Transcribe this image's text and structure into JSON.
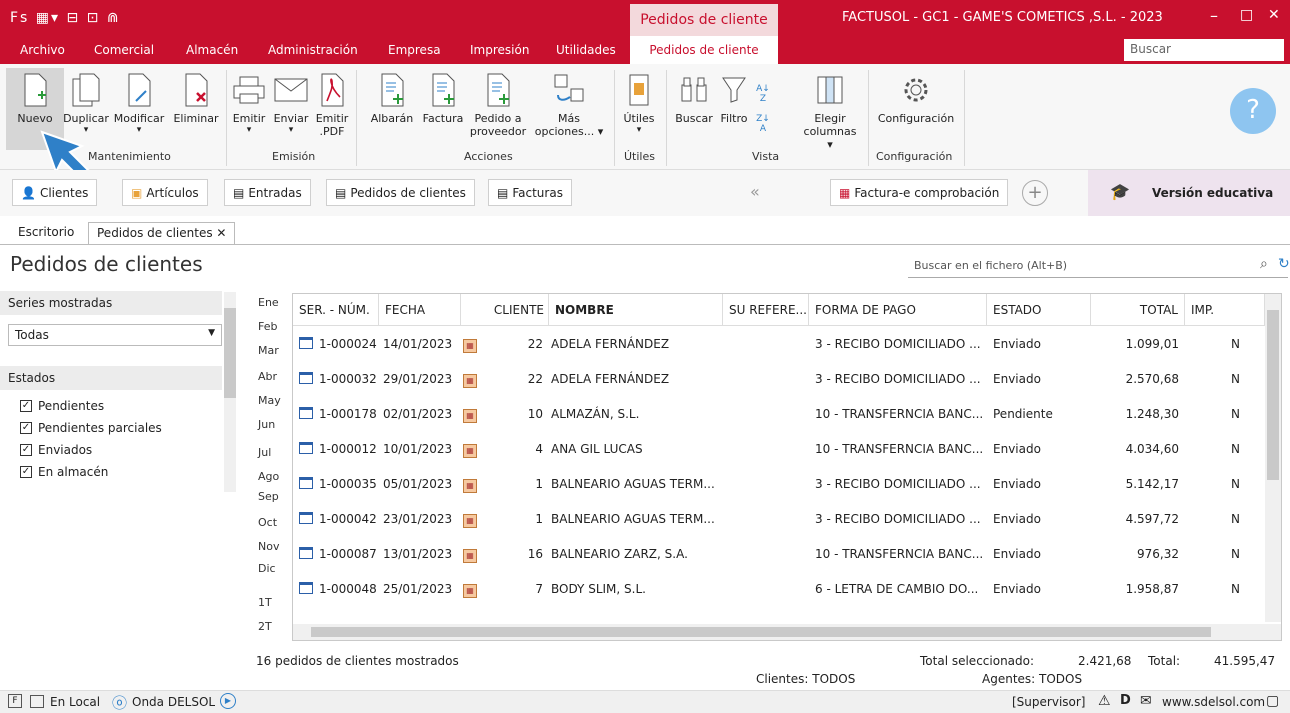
{
  "titlebar": {
    "quick_icons": "Fs ▦▾ ⊟ ⊡ ⋒",
    "context_tab": "Pedidos de cliente",
    "app_title": "FACTUSOL - GC1 - GAME'S COMETICS ,S.L. - 2023",
    "min": "–",
    "max": "□",
    "close": "✕"
  },
  "menu": {
    "items": [
      "Archivo",
      "Comercial",
      "Almacén",
      "Administración",
      "Empresa",
      "Impresión",
      "Utilidades",
      "Pedidos de cliente"
    ],
    "search_placeholder": "Buscar"
  },
  "ribbon": {
    "buttons": {
      "nuevo": "Nuevo",
      "duplicar": "Duplicar",
      "modificar": "Modificar",
      "eliminar": "Eliminar",
      "emitir": "Emitir",
      "enviar": "Enviar",
      "emitir_pdf_1": "Emitir",
      "emitir_pdf_2": ".PDF",
      "albaran": "Albarán",
      "factura": "Factura",
      "pedido_prov_1": "Pedido a",
      "pedido_prov_2": "proveedor",
      "mas_1": "Más",
      "mas_2": "opciones... ▾",
      "utiles": "Útiles",
      "buscar": "Buscar",
      "filtro": "Filtro",
      "elegir_1": "Elegir",
      "elegir_2": "columnas ▾",
      "configuracion": "Configuración"
    },
    "groups": {
      "mantenimiento": "Mantenimiento",
      "emision": "Emisión",
      "acciones": "Acciones",
      "utiles": "Útiles",
      "vista": "Vista",
      "configuracion": "Configuración"
    }
  },
  "nav": {
    "clientes": "Clientes",
    "articulos": "Artículos",
    "entradas": "Entradas",
    "pedidos": "Pedidos de clientes",
    "facturas": "Facturas",
    "collapse": "«",
    "facturae": "Factura-e comprobación",
    "plus": "+",
    "edu": "Versión educativa"
  },
  "tabs": {
    "escritorio": "Escritorio",
    "pedidos": "Pedidos de clientes ✕"
  },
  "page": {
    "title": "Pedidos de clientes",
    "search_placeholder": "Buscar en el fichero (Alt+B)"
  },
  "left": {
    "series_label": "Series mostradas",
    "series_value": "Todas",
    "estados_label": "Estados",
    "estados": [
      "Pendientes",
      "Pendientes parciales",
      "Enviados",
      "En almacén"
    ]
  },
  "months": [
    "Ene",
    "Feb",
    "Mar",
    "Abr",
    "May",
    "Jun",
    "Jul",
    "Ago",
    "Sep",
    "Oct",
    "Nov",
    "Dic",
    "1T",
    "2T"
  ],
  "table": {
    "headers": [
      "SER. - NÚM.",
      "FECHA",
      "CLIENTE",
      "NOMBRE",
      "SU REFERE...",
      "FORMA DE PAGO",
      "ESTADO",
      "TOTAL",
      "IMP."
    ],
    "rows": [
      [
        "1-000024",
        "14/01/2023",
        "22",
        "ADELA FERNÁNDEZ",
        "",
        "3 - RECIBO DOMICILIADO ...",
        "Enviado",
        "1.099,01",
        "N"
      ],
      [
        "1-000032",
        "29/01/2023",
        "22",
        "ADELA FERNÁNDEZ",
        "",
        "3 - RECIBO DOMICILIADO ...",
        "Enviado",
        "2.570,68",
        "N"
      ],
      [
        "1-000178",
        "02/01/2023",
        "10",
        "ALMAZÁN, S.L.",
        "",
        "10 - TRANSFERNCIA BANC...",
        "Pendiente",
        "1.248,30",
        "N"
      ],
      [
        "1-000012",
        "10/01/2023",
        "4",
        "ANA GIL LUCAS",
        "",
        "10 - TRANSFERNCIA BANC...",
        "Enviado",
        "4.034,60",
        "N"
      ],
      [
        "1-000035",
        "05/01/2023",
        "1",
        "BALNEARIO AGUAS TERM...",
        "",
        "3 - RECIBO DOMICILIADO ...",
        "Enviado",
        "5.142,17",
        "N"
      ],
      [
        "1-000042",
        "23/01/2023",
        "1",
        "BALNEARIO AGUAS TERM...",
        "",
        "3 - RECIBO DOMICILIADO ...",
        "Enviado",
        "4.597,72",
        "N"
      ],
      [
        "1-000087",
        "13/01/2023",
        "16",
        "BALNEARIO ZARZ, S.A.",
        "",
        "10 - TRANSFERNCIA BANC...",
        "Enviado",
        "976,32",
        "N"
      ],
      [
        "1-000048",
        "25/01/2023",
        "7",
        "BODY SLIM, S.L.",
        "",
        "6 - LETRA DE CAMBIO DO...",
        "Enviado",
        "1.958,87",
        "N"
      ]
    ]
  },
  "footer": {
    "count": "16 pedidos de clientes mostrados",
    "total_sel_label": "Total seleccionado:",
    "total_sel": "2.421,68",
    "total_label": "Total:",
    "total": "41.595,47",
    "clientes": "Clientes: TODOS",
    "agentes": "Agentes: TODOS"
  },
  "status": {
    "local": "En Local",
    "onda": "Onda DELSOL",
    "supervisor": "[Supervisor]",
    "web": "www.sdelsol.com"
  },
  "colors": {
    "brand": "#c8102e",
    "accent_arrow": "#2f80c8"
  }
}
